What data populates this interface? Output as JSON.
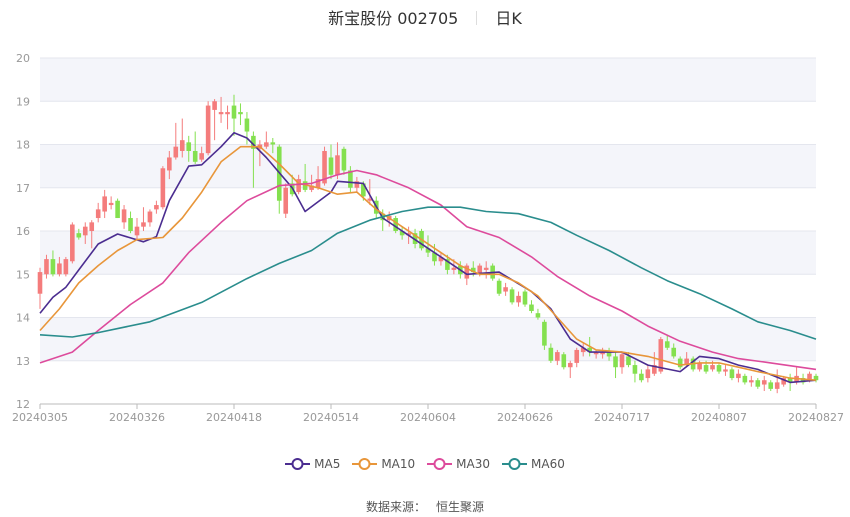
{
  "header": {
    "stock_name": "新宝股份 002705",
    "period": "日K"
  },
  "source": {
    "label": "数据来源：",
    "value": "恒生聚源"
  },
  "colors": {
    "up": "#f47c7c",
    "down": "#84e04f",
    "MA5": "#4b2d90",
    "MA10": "#e8963a",
    "MA30": "#dd4b9c",
    "MA60": "#2a8d8d",
    "band": "#f4f5fa",
    "grid": "#e4e6ee",
    "axis": "#999999"
  },
  "chart_data": {
    "type": "candlestick",
    "title": "新宝股份 002705 日K",
    "ylim": [
      12,
      20
    ],
    "yticks": [
      "12",
      "13",
      "14",
      "15",
      "16",
      "17",
      "18",
      "19",
      "20"
    ],
    "xtick_labels": [
      "20240305",
      "20240326",
      "20240418",
      "20240514",
      "20240604",
      "20240626",
      "20240717",
      "20240807",
      "20240827"
    ],
    "xtick_index": [
      0,
      15,
      30,
      45,
      60,
      75,
      90,
      105,
      120
    ],
    "legend": [
      "MA5",
      "MA10",
      "MA30",
      "MA60"
    ],
    "legend_position": "bottom",
    "candles_format": [
      "open",
      "close",
      "low",
      "high"
    ],
    "candles": [
      [
        14.55,
        15.05,
        14.2,
        15.15
      ],
      [
        15.0,
        15.35,
        14.9,
        15.45
      ],
      [
        15.35,
        15.0,
        14.95,
        15.55
      ],
      [
        15.0,
        15.25,
        14.95,
        15.4
      ],
      [
        15.0,
        15.35,
        14.95,
        15.4
      ],
      [
        15.3,
        16.15,
        15.25,
        16.2
      ],
      [
        15.95,
        15.85,
        15.8,
        16.05
      ],
      [
        15.9,
        16.1,
        15.7,
        16.2
      ],
      [
        16.0,
        16.2,
        15.6,
        16.25
      ],
      [
        16.3,
        16.5,
        16.2,
        16.65
      ],
      [
        16.45,
        16.8,
        16.3,
        16.95
      ],
      [
        16.6,
        16.65,
        16.5,
        16.8
      ],
      [
        16.7,
        16.3,
        16.3,
        16.75
      ],
      [
        16.2,
        16.5,
        16.05,
        16.6
      ],
      [
        16.3,
        16.0,
        15.95,
        16.45
      ],
      [
        15.9,
        16.1,
        15.8,
        16.3
      ],
      [
        16.1,
        16.2,
        16.0,
        16.55
      ],
      [
        16.2,
        16.45,
        16.1,
        16.5
      ],
      [
        16.5,
        16.6,
        16.4,
        16.7
      ],
      [
        16.55,
        17.45,
        16.5,
        17.5
      ],
      [
        17.4,
        17.7,
        17.2,
        17.85
      ],
      [
        17.7,
        17.95,
        17.65,
        18.5
      ],
      [
        17.85,
        18.1,
        17.7,
        18.6
      ],
      [
        18.05,
        17.85,
        17.6,
        18.2
      ],
      [
        17.85,
        17.6,
        17.55,
        18.3
      ],
      [
        17.65,
        17.8,
        17.6,
        17.95
      ],
      [
        17.8,
        18.9,
        17.75,
        19.0
      ],
      [
        18.8,
        19.0,
        18.1,
        19.05
      ],
      [
        18.7,
        18.75,
        18.5,
        19.1
      ],
      [
        18.7,
        18.75,
        18.35,
        18.9
      ],
      [
        18.9,
        18.6,
        18.2,
        19.15
      ],
      [
        18.75,
        18.7,
        18.45,
        18.95
      ],
      [
        18.6,
        18.3,
        18.0,
        18.75
      ],
      [
        18.2,
        17.9,
        17.0,
        18.3
      ],
      [
        17.9,
        18.0,
        17.5,
        18.1
      ],
      [
        17.95,
        18.05,
        17.9,
        18.3
      ],
      [
        18.05,
        18.0,
        17.8,
        18.15
      ],
      [
        17.95,
        16.7,
        16.4,
        18.0
      ],
      [
        16.4,
        17.0,
        16.3,
        17.1
      ],
      [
        17.1,
        16.85,
        16.8,
        17.3
      ],
      [
        16.9,
        17.2,
        16.85,
        17.3
      ],
      [
        17.15,
        16.95,
        16.9,
        17.55
      ],
      [
        16.95,
        17.05,
        16.9,
        17.3
      ],
      [
        17.0,
        17.2,
        16.95,
        17.5
      ],
      [
        17.1,
        17.85,
        17.05,
        17.95
      ],
      [
        17.7,
        17.3,
        17.2,
        18.0
      ],
      [
        17.3,
        17.75,
        17.2,
        18.05
      ],
      [
        17.9,
        17.4,
        17.3,
        17.95
      ],
      [
        17.4,
        17.0,
        16.9,
        17.5
      ],
      [
        17.0,
        17.15,
        16.9,
        17.25
      ],
      [
        17.1,
        16.8,
        16.7,
        17.15
      ],
      [
        16.7,
        16.75,
        16.6,
        17.2
      ],
      [
        16.7,
        16.4,
        16.3,
        16.8
      ],
      [
        16.4,
        16.25,
        16.0,
        16.5
      ],
      [
        16.25,
        16.35,
        16.1,
        16.45
      ],
      [
        16.3,
        16.0,
        15.95,
        16.35
      ],
      [
        16.0,
        15.9,
        15.8,
        16.1
      ],
      [
        15.9,
        15.95,
        15.7,
        16.1
      ],
      [
        15.95,
        15.7,
        15.6,
        16.05
      ],
      [
        16.0,
        15.6,
        15.55,
        16.05
      ],
      [
        15.6,
        15.5,
        15.4,
        15.9
      ],
      [
        15.5,
        15.3,
        15.2,
        15.7
      ],
      [
        15.3,
        15.4,
        15.2,
        15.5
      ],
      [
        15.35,
        15.1,
        15.0,
        15.45
      ],
      [
        15.1,
        15.15,
        15.0,
        15.35
      ],
      [
        15.2,
        15.0,
        14.9,
        15.3
      ],
      [
        14.9,
        15.2,
        14.75,
        15.25
      ],
      [
        15.15,
        15.05,
        14.95,
        15.3
      ],
      [
        15.0,
        15.2,
        14.95,
        15.25
      ],
      [
        15.1,
        15.15,
        14.9,
        15.3
      ],
      [
        15.2,
        14.9,
        14.85,
        15.25
      ],
      [
        14.85,
        14.55,
        14.5,
        14.9
      ],
      [
        14.6,
        14.7,
        14.5,
        14.8
      ],
      [
        14.65,
        14.35,
        14.3,
        14.7
      ],
      [
        14.35,
        14.5,
        14.25,
        14.6
      ],
      [
        14.6,
        14.3,
        14.25,
        14.65
      ],
      [
        14.3,
        14.15,
        14.1,
        14.4
      ],
      [
        14.1,
        14.0,
        13.95,
        14.2
      ],
      [
        13.9,
        13.35,
        13.25,
        13.95
      ],
      [
        13.3,
        13.0,
        12.95,
        13.4
      ],
      [
        13.0,
        13.2,
        12.9,
        13.25
      ],
      [
        13.15,
        12.85,
        12.8,
        13.2
      ],
      [
        12.85,
        12.95,
        12.6,
        13.0
      ],
      [
        12.95,
        13.25,
        12.85,
        13.3
      ],
      [
        13.2,
        13.3,
        13.1,
        13.4
      ],
      [
        13.3,
        13.2,
        13.1,
        13.55
      ],
      [
        13.15,
        13.2,
        13.05,
        13.25
      ],
      [
        13.15,
        13.2,
        13.05,
        13.3
      ],
      [
        13.2,
        13.1,
        13.0,
        13.3
      ],
      [
        13.1,
        12.85,
        12.6,
        13.2
      ],
      [
        12.85,
        13.15,
        12.7,
        13.2
      ],
      [
        13.1,
        12.9,
        12.85,
        13.2
      ],
      [
        12.9,
        12.7,
        12.5,
        13.0
      ],
      [
        12.7,
        12.55,
        12.5,
        12.8
      ],
      [
        12.6,
        12.8,
        12.5,
        12.9
      ],
      [
        12.7,
        12.9,
        12.65,
        13.2
      ],
      [
        12.75,
        13.5,
        12.7,
        13.55
      ],
      [
        13.45,
        13.3,
        13.25,
        13.6
      ],
      [
        13.3,
        13.1,
        13.05,
        13.4
      ],
      [
        13.05,
        12.85,
        12.8,
        13.1
      ],
      [
        12.9,
        13.05,
        12.85,
        13.2
      ],
      [
        13.05,
        12.8,
        12.75,
        13.1
      ],
      [
        12.8,
        12.95,
        12.75,
        13.0
      ],
      [
        12.9,
        12.75,
        12.7,
        13.0
      ],
      [
        12.8,
        12.9,
        12.75,
        13.0
      ],
      [
        12.9,
        12.75,
        12.7,
        12.95
      ],
      [
        12.75,
        12.8,
        12.65,
        12.9
      ],
      [
        12.8,
        12.6,
        12.55,
        12.85
      ],
      [
        12.6,
        12.7,
        12.5,
        12.8
      ],
      [
        12.65,
        12.5,
        12.45,
        12.7
      ],
      [
        12.5,
        12.55,
        12.4,
        12.65
      ],
      [
        12.55,
        12.4,
        12.35,
        12.6
      ],
      [
        12.45,
        12.55,
        12.3,
        12.65
      ],
      [
        12.5,
        12.35,
        12.3,
        12.55
      ],
      [
        12.35,
        12.5,
        12.25,
        12.8
      ],
      [
        12.45,
        12.6,
        12.4,
        12.65
      ],
      [
        12.6,
        12.5,
        12.3,
        12.7
      ],
      [
        12.5,
        12.65,
        12.45,
        12.85
      ],
      [
        12.6,
        12.5,
        12.45,
        12.7
      ],
      [
        12.55,
        12.7,
        12.5,
        12.75
      ],
      [
        12.65,
        12.55,
        12.5,
        12.7
      ]
    ],
    "series": [
      {
        "name": "MA5",
        "points": [
          [
            0,
            14.1
          ],
          [
            2,
            14.47
          ],
          [
            4,
            14.7
          ],
          [
            6,
            15.1
          ],
          [
            9,
            15.7
          ],
          [
            12,
            15.93
          ],
          [
            16,
            15.75
          ],
          [
            18,
            15.87
          ],
          [
            20,
            16.7
          ],
          [
            23,
            17.5
          ],
          [
            25,
            17.53
          ],
          [
            28,
            17.95
          ],
          [
            30,
            18.27
          ],
          [
            32,
            18.15
          ],
          [
            35,
            17.7
          ],
          [
            39,
            17.0
          ],
          [
            41,
            16.45
          ],
          [
            45,
            16.9
          ],
          [
            46,
            17.15
          ],
          [
            50,
            17.1
          ],
          [
            53,
            16.3
          ],
          [
            57,
            15.9
          ],
          [
            60,
            15.6
          ],
          [
            66,
            15.0
          ],
          [
            71,
            15.05
          ],
          [
            76,
            14.6
          ],
          [
            79,
            14.2
          ],
          [
            82,
            13.5
          ],
          [
            85,
            13.2
          ],
          [
            90,
            13.2
          ],
          [
            94,
            12.9
          ],
          [
            99,
            12.75
          ],
          [
            102,
            13.1
          ],
          [
            105,
            13.05
          ],
          [
            108,
            12.9
          ],
          [
            111,
            12.8
          ],
          [
            116,
            12.5
          ],
          [
            120,
            12.55
          ]
        ]
      },
      {
        "name": "MA10",
        "points": [
          [
            0,
            13.7
          ],
          [
            3,
            14.2
          ],
          [
            6,
            14.8
          ],
          [
            9,
            15.2
          ],
          [
            12,
            15.55
          ],
          [
            15,
            15.8
          ],
          [
            19,
            15.85
          ],
          [
            22,
            16.3
          ],
          [
            25,
            16.9
          ],
          [
            28,
            17.6
          ],
          [
            31,
            17.95
          ],
          [
            34,
            17.95
          ],
          [
            37,
            17.55
          ],
          [
            40,
            17.1
          ],
          [
            43,
            17.0
          ],
          [
            46,
            16.85
          ],
          [
            49,
            16.9
          ],
          [
            52,
            16.5
          ],
          [
            56,
            16.1
          ],
          [
            59,
            15.8
          ],
          [
            62,
            15.5
          ],
          [
            65,
            15.2
          ],
          [
            68,
            15.0
          ],
          [
            71,
            15.0
          ],
          [
            74,
            14.8
          ],
          [
            77,
            14.5
          ],
          [
            80,
            14.0
          ],
          [
            83,
            13.5
          ],
          [
            86,
            13.25
          ],
          [
            90,
            13.2
          ],
          [
            94,
            13.1
          ],
          [
            99,
            12.9
          ],
          [
            102,
            12.95
          ],
          [
            105,
            12.95
          ],
          [
            108,
            12.85
          ],
          [
            111,
            12.75
          ],
          [
            116,
            12.6
          ],
          [
            120,
            12.55
          ]
        ]
      },
      {
        "name": "MA30",
        "points": [
          [
            0,
            12.95
          ],
          [
            5,
            13.2
          ],
          [
            9,
            13.7
          ],
          [
            14,
            14.3
          ],
          [
            19,
            14.8
          ],
          [
            23,
            15.5
          ],
          [
            28,
            16.2
          ],
          [
            32,
            16.7
          ],
          [
            37,
            17.05
          ],
          [
            42,
            17.1
          ],
          [
            46,
            17.3
          ],
          [
            49,
            17.4
          ],
          [
            52,
            17.3
          ],
          [
            57,
            17.0
          ],
          [
            62,
            16.6
          ],
          [
            66,
            16.1
          ],
          [
            71,
            15.85
          ],
          [
            76,
            15.4
          ],
          [
            80,
            14.95
          ],
          [
            85,
            14.5
          ],
          [
            90,
            14.15
          ],
          [
            94,
            13.8
          ],
          [
            99,
            13.45
          ],
          [
            104,
            13.2
          ],
          [
            108,
            13.05
          ],
          [
            113,
            12.95
          ],
          [
            120,
            12.8
          ]
        ]
      },
      {
        "name": "MA60",
        "points": [
          [
            0,
            13.6
          ],
          [
            5,
            13.55
          ],
          [
            9,
            13.65
          ],
          [
            17,
            13.9
          ],
          [
            25,
            14.35
          ],
          [
            32,
            14.9
          ],
          [
            37,
            15.25
          ],
          [
            42,
            15.55
          ],
          [
            46,
            15.95
          ],
          [
            51,
            16.25
          ],
          [
            56,
            16.45
          ],
          [
            60,
            16.55
          ],
          [
            65,
            16.55
          ],
          [
            69,
            16.45
          ],
          [
            74,
            16.4
          ],
          [
            79,
            16.2
          ],
          [
            83,
            15.9
          ],
          [
            88,
            15.55
          ],
          [
            93,
            15.15
          ],
          [
            97,
            14.85
          ],
          [
            102,
            14.55
          ],
          [
            107,
            14.2
          ],
          [
            111,
            13.9
          ],
          [
            116,
            13.7
          ],
          [
            120,
            13.5
          ]
        ]
      }
    ]
  }
}
